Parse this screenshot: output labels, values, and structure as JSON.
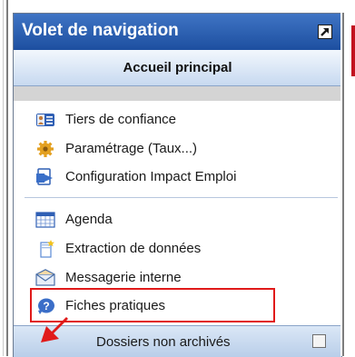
{
  "pane": {
    "title": "Volet de navigation",
    "home_label": "Accueil principal",
    "groups": [
      {
        "items": [
          {
            "label": "Tiers de confiance",
            "icon": "contact-card-icon"
          },
          {
            "label": "Paramétrage (Taux...)",
            "icon": "gear-icon"
          },
          {
            "label": "Configuration Impact Emploi",
            "icon": "document-arrow-icon"
          }
        ]
      },
      {
        "items": [
          {
            "label": "Agenda",
            "icon": "calendar-icon"
          },
          {
            "label": "Extraction de données",
            "icon": "extract-document-icon"
          },
          {
            "label": "Messagerie interne",
            "icon": "envelope-icon"
          },
          {
            "label": "Fiches pratiques",
            "icon": "help-icon"
          }
        ]
      }
    ],
    "footer_label": "Dossiers non archivés",
    "footer_checked": false
  },
  "colors": {
    "header": "#2a5db0",
    "home_bar": "#d7e5f7",
    "highlight": "#e01a1a",
    "arrow": "#e01a1a"
  }
}
